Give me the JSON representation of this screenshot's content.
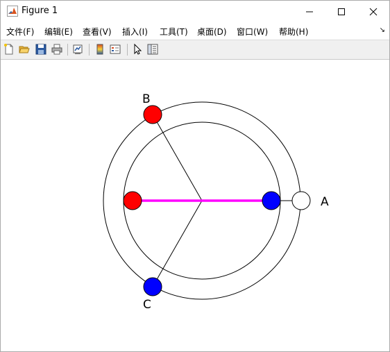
{
  "window": {
    "title": "Figure 1"
  },
  "menu": {
    "items": [
      "文件(F)",
      "编辑(E)",
      "查看(V)",
      "插入(I)",
      "工具(T)",
      "桌面(D)",
      "窗口(W)",
      "帮助(H)"
    ],
    "expand_glyph": "↘"
  },
  "toolbar": {
    "buttons": [
      {
        "name": "new-figure",
        "icon": "new-document-icon"
      },
      {
        "name": "open-file",
        "icon": "folder-open-icon"
      },
      {
        "name": "save-figure",
        "icon": "floppy-disk-icon"
      },
      {
        "name": "print-figure",
        "icon": "printer-icon"
      },
      {
        "name": "link-plot",
        "icon": "link-plot-icon"
      },
      {
        "name": "insert-colorbar",
        "icon": "colorbar-icon"
      },
      {
        "name": "insert-legend",
        "icon": "legend-icon"
      },
      {
        "name": "edit-plot",
        "icon": "pointer-arrow-icon"
      },
      {
        "name": "property-inspector",
        "icon": "property-inspector-icon"
      }
    ]
  },
  "figure": {
    "labels": {
      "a": "A",
      "b": "B",
      "c": "C"
    },
    "colors": {
      "red": "#ff0000",
      "blue": "#0000ff",
      "magenta": "#ff00ff",
      "line": "#000000",
      "open_marker": "#ffffff"
    }
  }
}
